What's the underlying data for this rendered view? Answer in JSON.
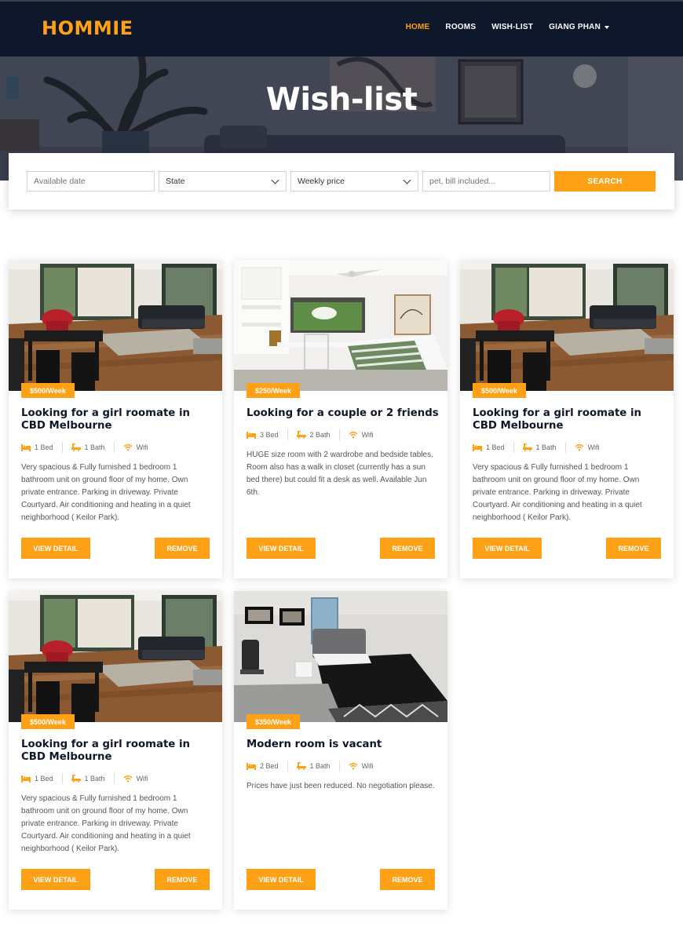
{
  "brand": "HOMMIE",
  "nav": {
    "items": [
      {
        "label": "HOME",
        "active": true
      },
      {
        "label": "ROOMS",
        "active": false
      },
      {
        "label": "WISH-LIST",
        "active": false
      },
      {
        "label": "GIANG PHAN",
        "active": false,
        "dropdown": true
      }
    ]
  },
  "hero": {
    "title": "Wish-list"
  },
  "search": {
    "date_placeholder": "Available date",
    "state_label": "State",
    "price_label": "Weekly price",
    "keyword_placeholder": "pet, bill included...",
    "button": "SEARCH"
  },
  "cards": [
    {
      "price": "$500/Week",
      "title": "Looking for a girl roomate in CBD Melbourne",
      "bed": "1 Bed",
      "bath": "1 Bath",
      "wifi": "Wifi",
      "desc": "Very spacious & Fully furnished 1 bedroom 1 bathroom unit on ground floor of my home. Own private entrance. Parking in driveway. Private Courtyard. Air conditioning and heating in a quiet neighborhood ( Keilor Park).",
      "view": "VIEW DETAIL",
      "remove": "REMOVE",
      "photo": "living-room"
    },
    {
      "price": "$250/Week",
      "title": "Looking for a couple or 2 friends",
      "bed": "3 Bed",
      "bath": "2 Bath",
      "wifi": "Wifi",
      "desc": "HUGE size room with 2 wardrobe and bedside tables. Room also has a walk in closet (currently has a sun bed there) but could fit a desk as well. Available Jun 6th.",
      "view": "VIEW DETAIL",
      "remove": "REMOVE",
      "photo": "white-bedroom"
    },
    {
      "price": "$500/Week",
      "title": "Looking for a girl roomate in CBD Melbourne",
      "bed": "1 Bed",
      "bath": "1 Bath",
      "wifi": "Wifi",
      "desc": "Very spacious & Fully furnished 1 bedroom 1 bathroom unit on ground floor of my home. Own private entrance. Parking in driveway. Private Courtyard. Air conditioning and heating in a quiet neighborhood ( Keilor Park).",
      "view": "VIEW DETAIL",
      "remove": "REMOVE",
      "photo": "living-room"
    },
    {
      "price": "$500/Week",
      "title": "Looking for a girl roomate in CBD Melbourne",
      "bed": "1 Bed",
      "bath": "1 Bath",
      "wifi": "Wifi",
      "desc": "Very spacious & Fully furnished 1 bedroom 1 bathroom unit on ground floor of my home. Own private entrance. Parking in driveway. Private Courtyard. Air conditioning and heating in a quiet neighborhood ( Keilor Park).",
      "view": "VIEW DETAIL",
      "remove": "REMOVE",
      "photo": "living-room"
    },
    {
      "price": "$350/Week",
      "title": "Modern room is vacant",
      "bed": "2 Bed",
      "bath": "1 Bath",
      "wifi": "Wifi",
      "desc": "Prices have just been reduced. No negotiation please.",
      "view": "VIEW DETAIL",
      "remove": "REMOVE",
      "photo": "dark-bedroom"
    }
  ],
  "colors": {
    "accent": "#fea116",
    "navy": "#0f172b"
  }
}
